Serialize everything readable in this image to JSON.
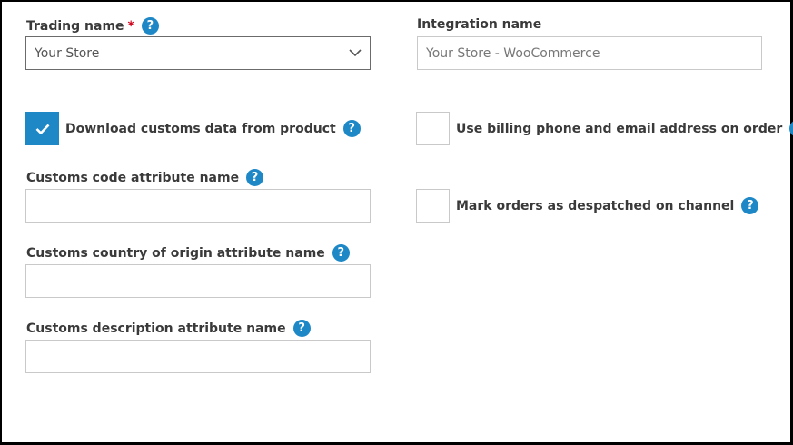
{
  "left": {
    "trading_name": {
      "label": "Trading name",
      "required_mark": "*",
      "selected": "Your Store",
      "icon": "chevron-down-icon"
    },
    "download_customs": {
      "label": "Download customs data from product",
      "checked": true
    },
    "customs_code": {
      "label": "Customs code attribute name",
      "value": ""
    },
    "customs_country": {
      "label": "Customs country of origin attribute name",
      "value": ""
    },
    "customs_description": {
      "label": "Customs description attribute name",
      "value": ""
    }
  },
  "right": {
    "integration_name": {
      "label": "Integration name",
      "placeholder": "Your Store - WooCommerce"
    },
    "use_billing": {
      "label": "Use billing phone and email address on order",
      "checked": false
    },
    "mark_despatched": {
      "label": "Mark orders as despatched on channel",
      "checked": false
    }
  },
  "help_glyph": "?",
  "colors": {
    "accent": "#1e88c7",
    "required": "#d0021b"
  }
}
